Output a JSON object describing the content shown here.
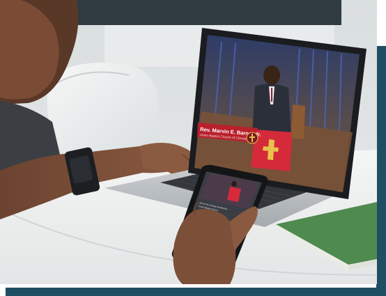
{
  "scene": {
    "laptop_screen": {
      "lower_third": {
        "name": "Rev. Marvin E. Barner Jr.",
        "subtitle": "Union Baptist Church of Chester, PA"
      }
    },
    "phone_screen": {
      "caption_line_1": "Join us for Sunday worship live",
      "caption_line_2": "Union Baptist Church"
    }
  },
  "colors": {
    "frame_accent": "#1f4e63",
    "lower_third_red": "#b8202c",
    "pulpit_red": "#d42a3a",
    "book_green": "#4f8a4f"
  }
}
